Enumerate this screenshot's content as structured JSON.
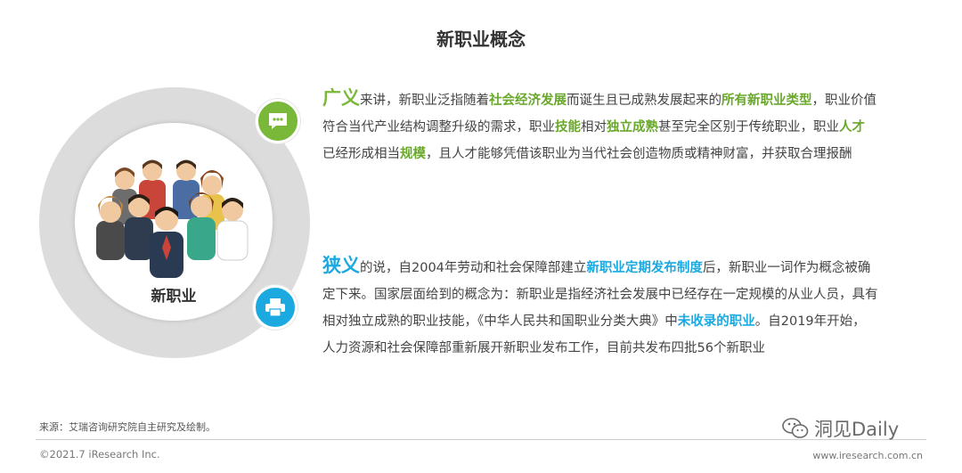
{
  "title": "新职业概念",
  "circle_label": "新职业",
  "icons": {
    "badge1": "chat-bubble-icon",
    "badge2": "printer-icon",
    "illustration": "people-group-icon",
    "watermark": "wechat-icon"
  },
  "colors": {
    "green": "#7ab83a",
    "blue": "#1ba9e0",
    "ring": "#dcdcdc"
  },
  "broad": {
    "heading": "广义",
    "lines": [
      [
        "来讲，新职业泛指随着",
        "社会经济发展",
        "而诞生且已成熟发展起来的",
        "所有新职业类型",
        "，职业价值"
      ],
      [
        "符合当代产业结构调整升级的需求，职业",
        "技能",
        "相对",
        "独立成熟",
        "甚至完全区别于传统职业，职业",
        "人才"
      ],
      [
        "已经形成相当",
        "规模",
        "，且人才能够凭借该职业为当代社会创造物质或精神财富，并获取合理报酬"
      ]
    ]
  },
  "narrow": {
    "heading": "狭义",
    "lines": [
      [
        "的说，自2004年劳动和社会保障部建立",
        "新职业定期发布制度",
        "后，新职业一词作为概念被确"
      ],
      [
        "定下来。国家层面给到的概念为：新职业是指经济社会发展中已经存在一定规模的从业人员，具有"
      ],
      [
        "相对独立成熟的职业技能，《中华人民共和国职业分类大典》中",
        "未收录的职业",
        "。自2019年开始，"
      ],
      [
        "人力资源和社会保障部重新展开新职业发布工作，目前共发布四批56个新职业"
      ]
    ]
  },
  "footer": {
    "source": "来源：艾瑞咨询研究院自主研究及绘制。",
    "copyright": "©2021.7 iResearch Inc.",
    "website": "www.iresearch.com.cn",
    "watermark": "洞见Daily"
  }
}
